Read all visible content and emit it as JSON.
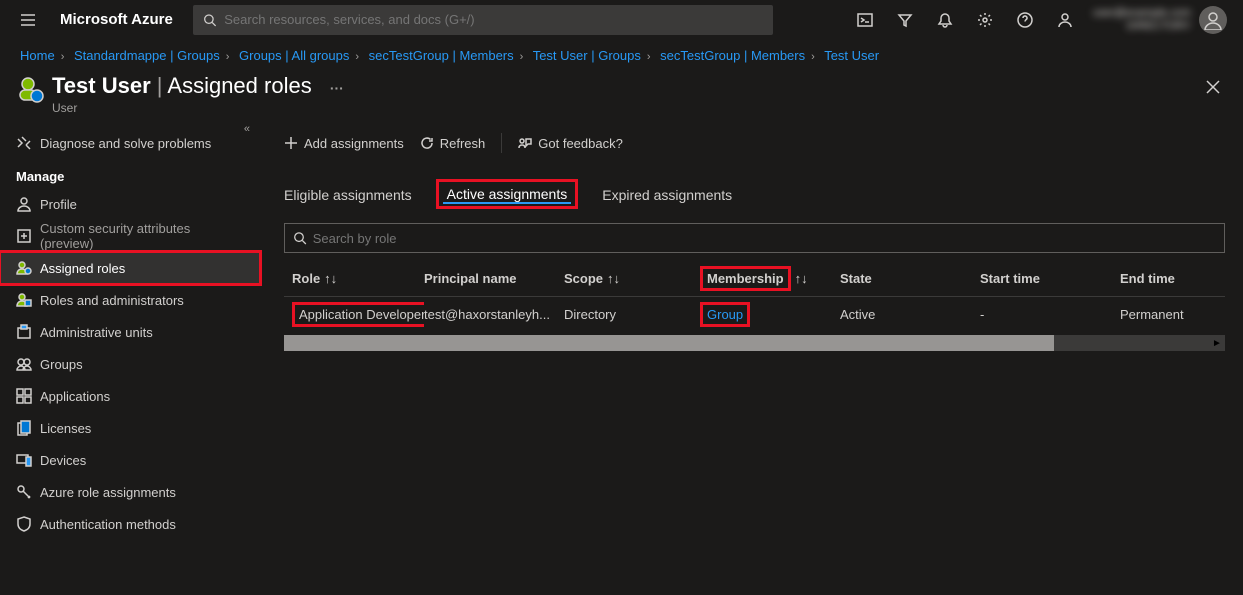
{
  "header": {
    "brand": "Microsoft Azure",
    "search_placeholder": "Search resources, services, and docs (G+/)",
    "account_line1": "user@example.com",
    "account_line2": "DIRECTORY"
  },
  "breadcrumbs": [
    "Home",
    "Standardmappe | Groups",
    "Groups | All groups",
    "secTestGroup | Members",
    "Test User | Groups",
    "secTestGroup | Members",
    "Test User"
  ],
  "title": {
    "entity": "Test User",
    "page": "Assigned roles",
    "subtype": "User"
  },
  "sidebar": {
    "top": [
      {
        "label": "Diagnose and solve problems",
        "icon": "diagnose",
        "active": false,
        "muted": false
      }
    ],
    "manage_header": "Manage",
    "manage": [
      {
        "label": "Profile",
        "icon": "profile"
      },
      {
        "label": "Custom security attributes (preview)",
        "icon": "custom-sec",
        "muted": true
      },
      {
        "label": "Assigned roles",
        "icon": "assigned-roles",
        "active": true,
        "highlight": true
      },
      {
        "label": "Roles and administrators",
        "icon": "roles-admin"
      },
      {
        "label": "Administrative units",
        "icon": "admin-units"
      },
      {
        "label": "Groups",
        "icon": "groups"
      },
      {
        "label": "Applications",
        "icon": "applications"
      },
      {
        "label": "Licenses",
        "icon": "licenses"
      },
      {
        "label": "Devices",
        "icon": "devices"
      },
      {
        "label": "Azure role assignments",
        "icon": "key"
      },
      {
        "label": "Authentication methods",
        "icon": "shield"
      }
    ]
  },
  "toolbar": {
    "add": "Add assignments",
    "refresh": "Refresh",
    "feedback": "Got feedback?"
  },
  "tabs": {
    "eligible": "Eligible assignments",
    "active": "Active assignments",
    "expired": "Expired assignments",
    "active_tab": "active"
  },
  "role_search_placeholder": "Search by role",
  "columns": {
    "role": "Role",
    "principal": "Principal name",
    "scope": "Scope",
    "membership": "Membership",
    "state": "State",
    "start": "Start time",
    "end": "End time"
  },
  "rows": [
    {
      "role": "Application Developer",
      "principal": "test@haxorstanleyh...",
      "scope": "Directory",
      "membership": "Group",
      "state": "Active",
      "start": "-",
      "end": "Permanent",
      "role_highlight": true,
      "membership_highlight": true,
      "membership_link": true
    }
  ]
}
